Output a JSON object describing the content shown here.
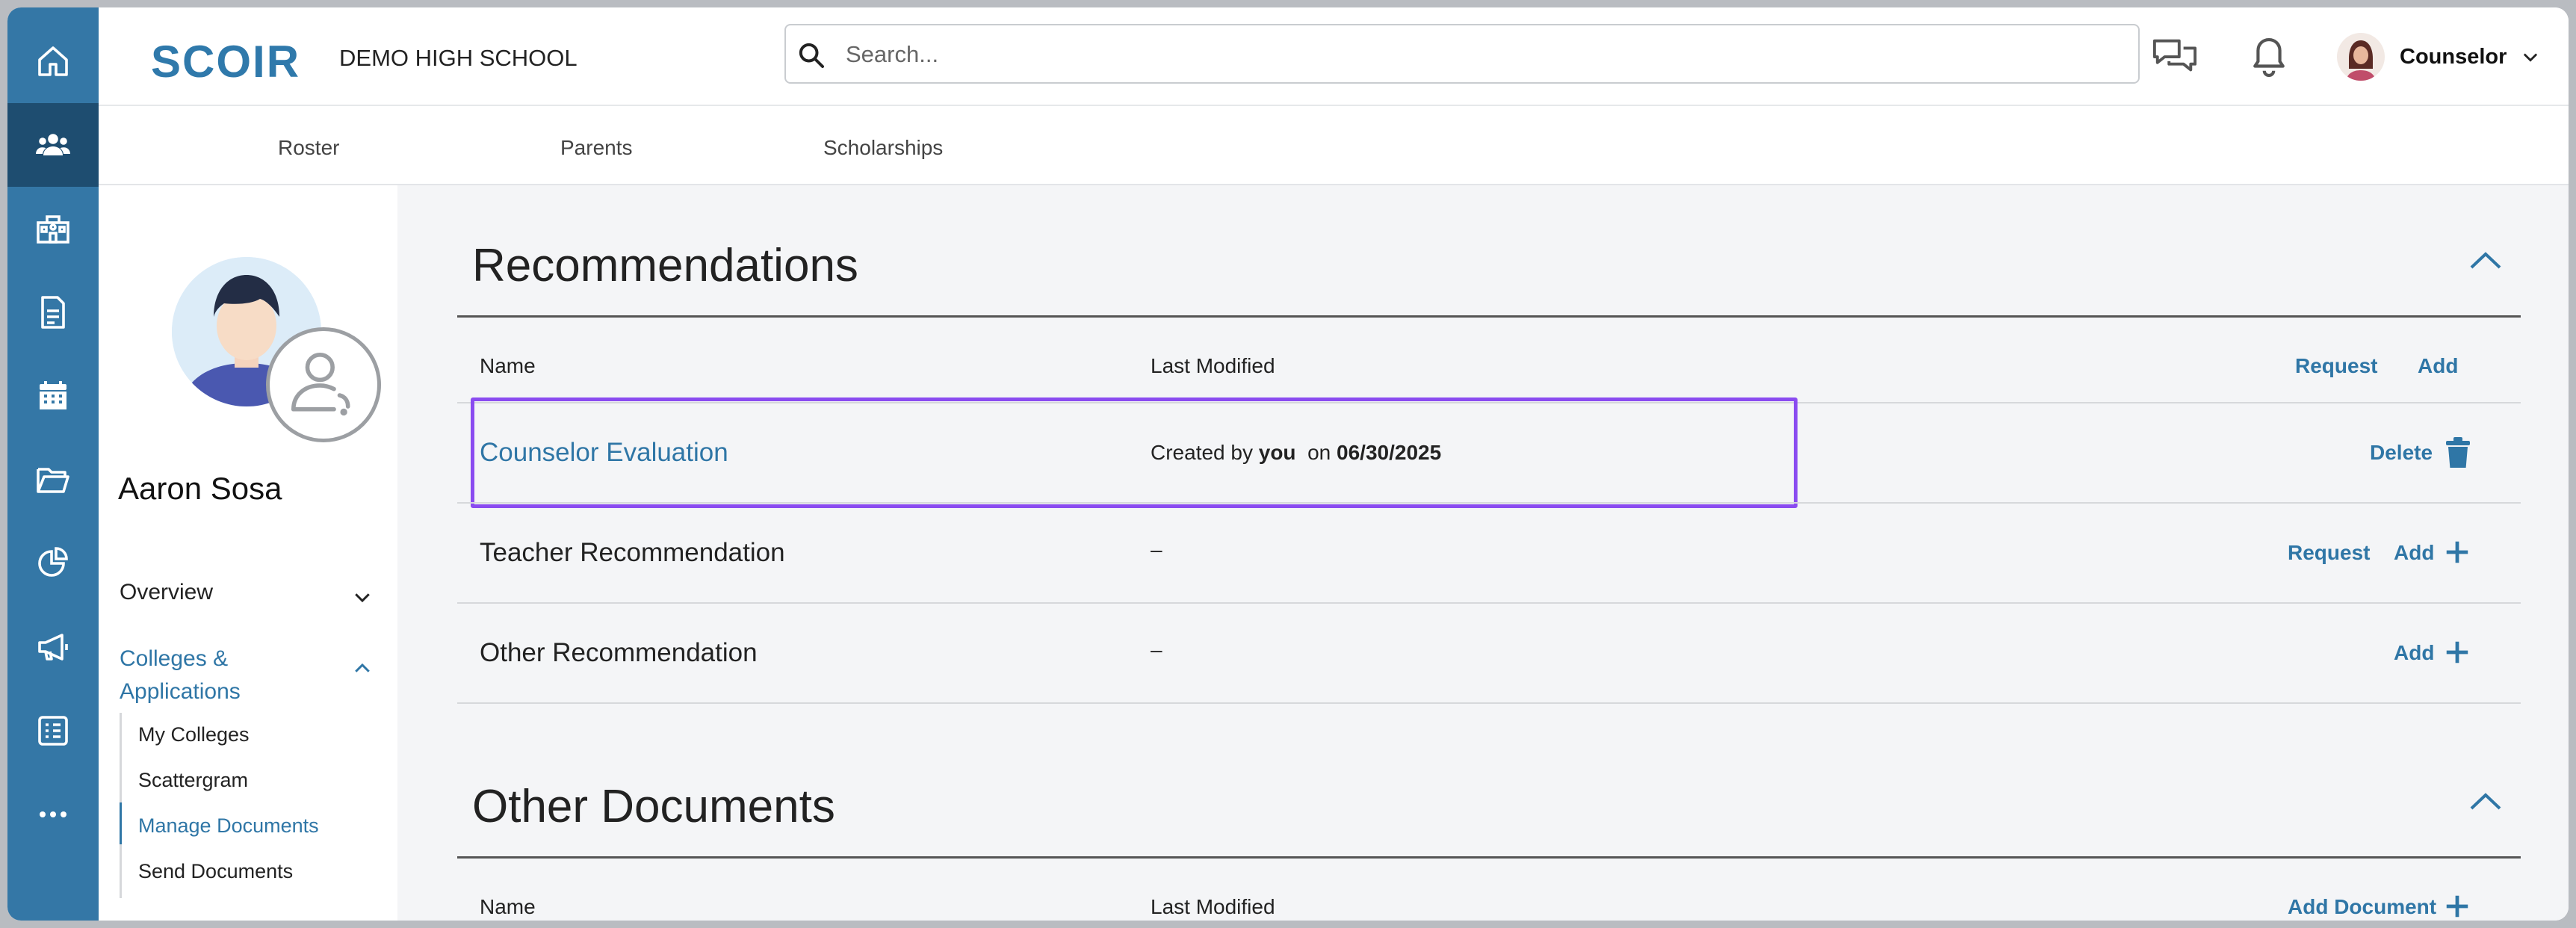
{
  "header": {
    "logo": "SCOIR",
    "school_name": "DEMO HIGH SCHOOL",
    "search_placeholder": "Search...",
    "user_label": "Counselor"
  },
  "rail": {
    "icons": [
      "home-icon",
      "students-icon",
      "school-icon",
      "document-icon",
      "calendar-icon",
      "folder-icon",
      "analytics-icon",
      "megaphone-icon",
      "checklist-icon",
      "more-icon"
    ],
    "active": "students-icon"
  },
  "subnav": {
    "items": [
      "Roster",
      "Parents",
      "Scholarships"
    ]
  },
  "student": {
    "name": "Aaron Sosa",
    "overview": "Overview",
    "colleges_line1": "Colleges &",
    "colleges_line2": "Applications",
    "sub_items": [
      "My Colleges",
      "Scattergram",
      "Manage Documents",
      "Send Documents"
    ],
    "active_sub": "Manage Documents"
  },
  "recommendations": {
    "title": "Recommendations",
    "col_name": "Name",
    "col_modified": "Last Modified",
    "request_label": "Request",
    "add_label": "Add",
    "rows": [
      {
        "name": "Counselor Evaluation",
        "created_prefix": "Created by",
        "created_by": "you",
        "created_on": "on",
        "date": "06/30/2025",
        "action": "Delete"
      },
      {
        "name": "Teacher Recommendation",
        "modified": "–",
        "request": "Request",
        "add": "Add"
      },
      {
        "name": "Other Recommendation",
        "modified": "–",
        "add": "Add"
      }
    ]
  },
  "other_documents": {
    "title": "Other Documents",
    "col_name": "Name",
    "col_modified": "Last Modified",
    "add_label": "Add Document"
  },
  "colors": {
    "rail": "#3477a6",
    "rail_active": "#1e4d70",
    "link": "#2f76a6",
    "highlight": "#8a4bf0"
  }
}
